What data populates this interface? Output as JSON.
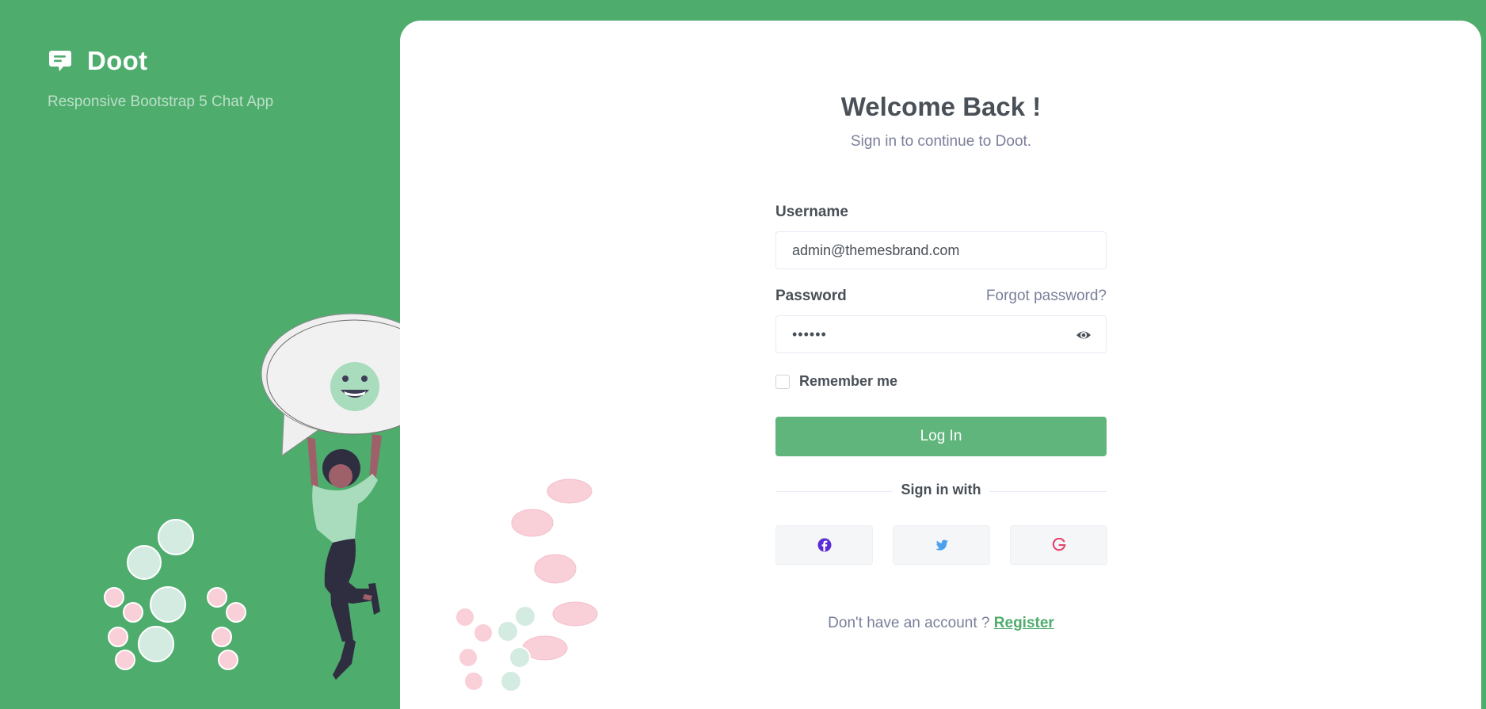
{
  "brand": {
    "name": "Doot",
    "tagline": "Responsive Bootstrap 5 Chat App",
    "icon": "chat-bubble-icon"
  },
  "login": {
    "title": "Welcome Back !",
    "subtitle": "Sign in to continue to Doot.",
    "username_label": "Username",
    "username_value": "admin@themesbrand.com",
    "password_label": "Password",
    "forgot_link": "Forgot password?",
    "password_value": "••••••",
    "password_toggle_icon": "eye-icon",
    "remember_label": "Remember me",
    "remember_checked": false,
    "login_button": "Log In",
    "social_divider": "Sign in with",
    "social_buttons": [
      {
        "name": "facebook",
        "icon": "facebook-icon",
        "color": "#5b2bd6"
      },
      {
        "name": "twitter",
        "icon": "twitter-icon",
        "color": "#4aa1eb"
      },
      {
        "name": "google",
        "icon": "google-icon",
        "color": "#e83e6c"
      }
    ],
    "register_prompt": "Don't have an account ?",
    "register_link": "Register"
  },
  "colors": {
    "primary": "#4eac6d",
    "button": "#5fb57b",
    "heading": "#495057",
    "muted": "#7a7f9a",
    "card": "#ffffff"
  }
}
